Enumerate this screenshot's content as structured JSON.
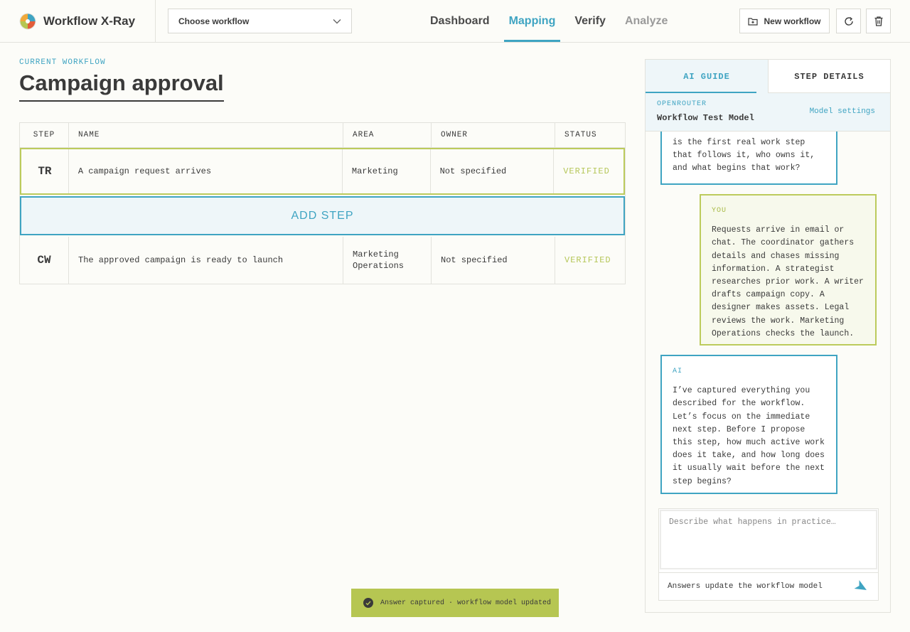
{
  "app": {
    "title": "Workflow X-Ray"
  },
  "workflow_select": {
    "value": "Choose workflow"
  },
  "nav": {
    "tabs": [
      {
        "label": "Dashboard",
        "state": "normal"
      },
      {
        "label": "Mapping",
        "state": "active"
      },
      {
        "label": "Verify",
        "state": "normal"
      },
      {
        "label": "Analyze",
        "state": "disabled"
      }
    ]
  },
  "actions": {
    "new_workflow": "New workflow"
  },
  "workflow": {
    "label": "CURRENT WORKFLOW",
    "title": "Campaign approval"
  },
  "table": {
    "headers": [
      "STEP",
      "NAME",
      "AREA",
      "OWNER",
      "STATUS"
    ],
    "rows": [
      {
        "step": "TR",
        "name": "A campaign request arrives",
        "area": "Marketing",
        "owner": "Not specified",
        "status": "VERIFIED"
      },
      {
        "step": "CW",
        "name": "The approved campaign is ready to launch",
        "area": "Marketing Operations",
        "owner": "Not specified",
        "status": "VERIFIED"
      }
    ],
    "add_step": "ADD STEP"
  },
  "toast": {
    "text": "Answer captured · workflow model updated"
  },
  "panel": {
    "tabs": [
      "AI GUIDE",
      "STEP DETAILS"
    ],
    "provider_label": "OPENROUTER",
    "model_name": "Workflow Test Model",
    "model_settings": "Model settings",
    "messages": [
      {
        "role": "",
        "text": "is the first real work step that follows it, who owns it, and what begins that work?"
      },
      {
        "role": "YOU",
        "text": "Requests arrive in email or chat. The coordinator gathers details and chases missing information. A strategist researches prior work. A writer drafts campaign copy. A designer makes assets. Legal reviews the work. Marketing Operations checks the launch."
      },
      {
        "role": "AI",
        "text": "I’ve captured everything you described for the workflow. Let’s focus on the immediate next step. Before I propose this step, how much active work does it take, and how long does it usually wait before the next step begins?"
      }
    ],
    "composer": {
      "placeholder": "Describe what happens in practice…",
      "footer": "Answers update the workflow model"
    }
  },
  "colors": {
    "accent": "#3fa4c2",
    "verified": "#b6c652",
    "text": "#3a3a3a"
  }
}
